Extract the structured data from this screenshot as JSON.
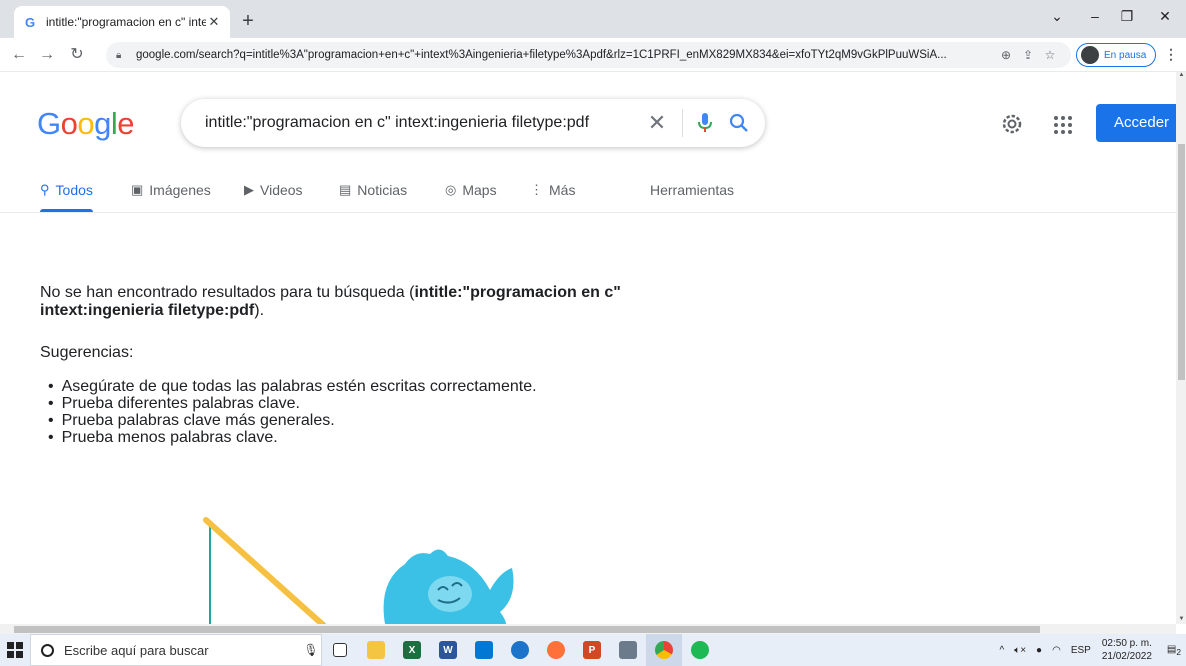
{
  "browser": {
    "tab_title": "intitle:\"programacion en c\" intext",
    "url": "google.com/search?q=intitle%3A\"programacion+en+c\"+intext%3Aingenieria+filetype%3Apdf&rlz=1C1PRFI_enMX829MX834&ei=xfoTYt2qM9vGkPlPuuWSiA...",
    "profile_label": "En pausa"
  },
  "google": {
    "logo": [
      "G",
      "o",
      "o",
      "g",
      "l",
      "e"
    ],
    "logo_colors": [
      "#4285f4",
      "#ea4335",
      "#fbbc05",
      "#4285f4",
      "#34a853",
      "#ea4335"
    ],
    "query": "intitle:\"programacion en c\" intext:ingenieria filetype:pdf",
    "signin_label": "Acceder",
    "tabs": [
      {
        "label": "Todos",
        "icon": "search-icon"
      },
      {
        "label": "Imágenes",
        "icon": "image-icon"
      },
      {
        "label": "Videos",
        "icon": "play-icon"
      },
      {
        "label": "Noticias",
        "icon": "news-icon"
      },
      {
        "label": "Maps",
        "icon": "location-icon"
      },
      {
        "label": "Más",
        "icon": "more-icon"
      },
      {
        "label": "Herramientas",
        "icon": ""
      }
    ],
    "no_results_prefix": "No se han encontrado resultados para tu búsqueda (",
    "no_results_query_line1": "intitle:\"programacion en c\"",
    "no_results_query_line2": "intext:ingenieria filetype:pdf",
    "no_results_suffix": ").",
    "suggestions_title": "Sugerencias:",
    "suggestions": [
      "Asegúrate de que todas las palabras estén escritas correctamente.",
      "Prueba diferentes palabras clave.",
      "Prueba palabras clave más generales.",
      "Prueba menos palabras clave."
    ]
  },
  "taskbar": {
    "search_placeholder": "Escribe aquí para buscar",
    "language": "ESP",
    "time": "02:50 p. m.",
    "date": "21/02/2022",
    "notification_count": "2"
  }
}
